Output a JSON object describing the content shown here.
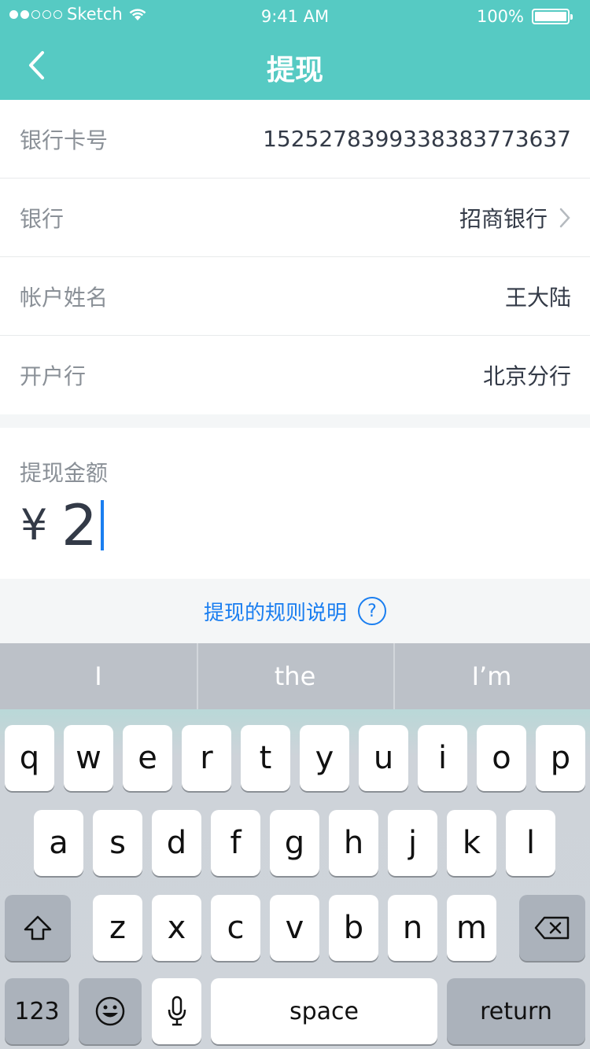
{
  "status_bar": {
    "carrier": "Sketch",
    "time": "9:41 AM",
    "battery": "100%"
  },
  "nav": {
    "title": "提现",
    "back_icon": "chevron-left-icon"
  },
  "form_rows": [
    {
      "label": "银行卡号",
      "value": "15252783993383837736 37"
    },
    {
      "label": "银行",
      "value": "招商银行"
    },
    {
      "label": "帐户姓名",
      "value": "王大陆"
    },
    {
      "label": "开户行",
      "value": "北京分行"
    }
  ],
  "amount": {
    "label": "提现金额",
    "currency": "¥",
    "value": "2"
  },
  "rules": {
    "label": "提现的规则说明",
    "help_symbol": "?"
  },
  "keyboard": {
    "suggestions": [
      "I",
      "the",
      "I’m"
    ],
    "row1": [
      "q",
      "w",
      "e",
      "r",
      "t",
      "y",
      "u",
      "i",
      "o",
      "p"
    ],
    "row2": [
      "a",
      "s",
      "d",
      "f",
      "g",
      "h",
      "j",
      "k",
      "l"
    ],
    "row3": [
      "z",
      "x",
      "c",
      "v",
      "b",
      "n",
      "m"
    ],
    "numbers_label": "123",
    "space_label": "space",
    "return_label": "return"
  },
  "colors": {
    "header": "#56cac3",
    "accent": "#1a7ef0"
  }
}
